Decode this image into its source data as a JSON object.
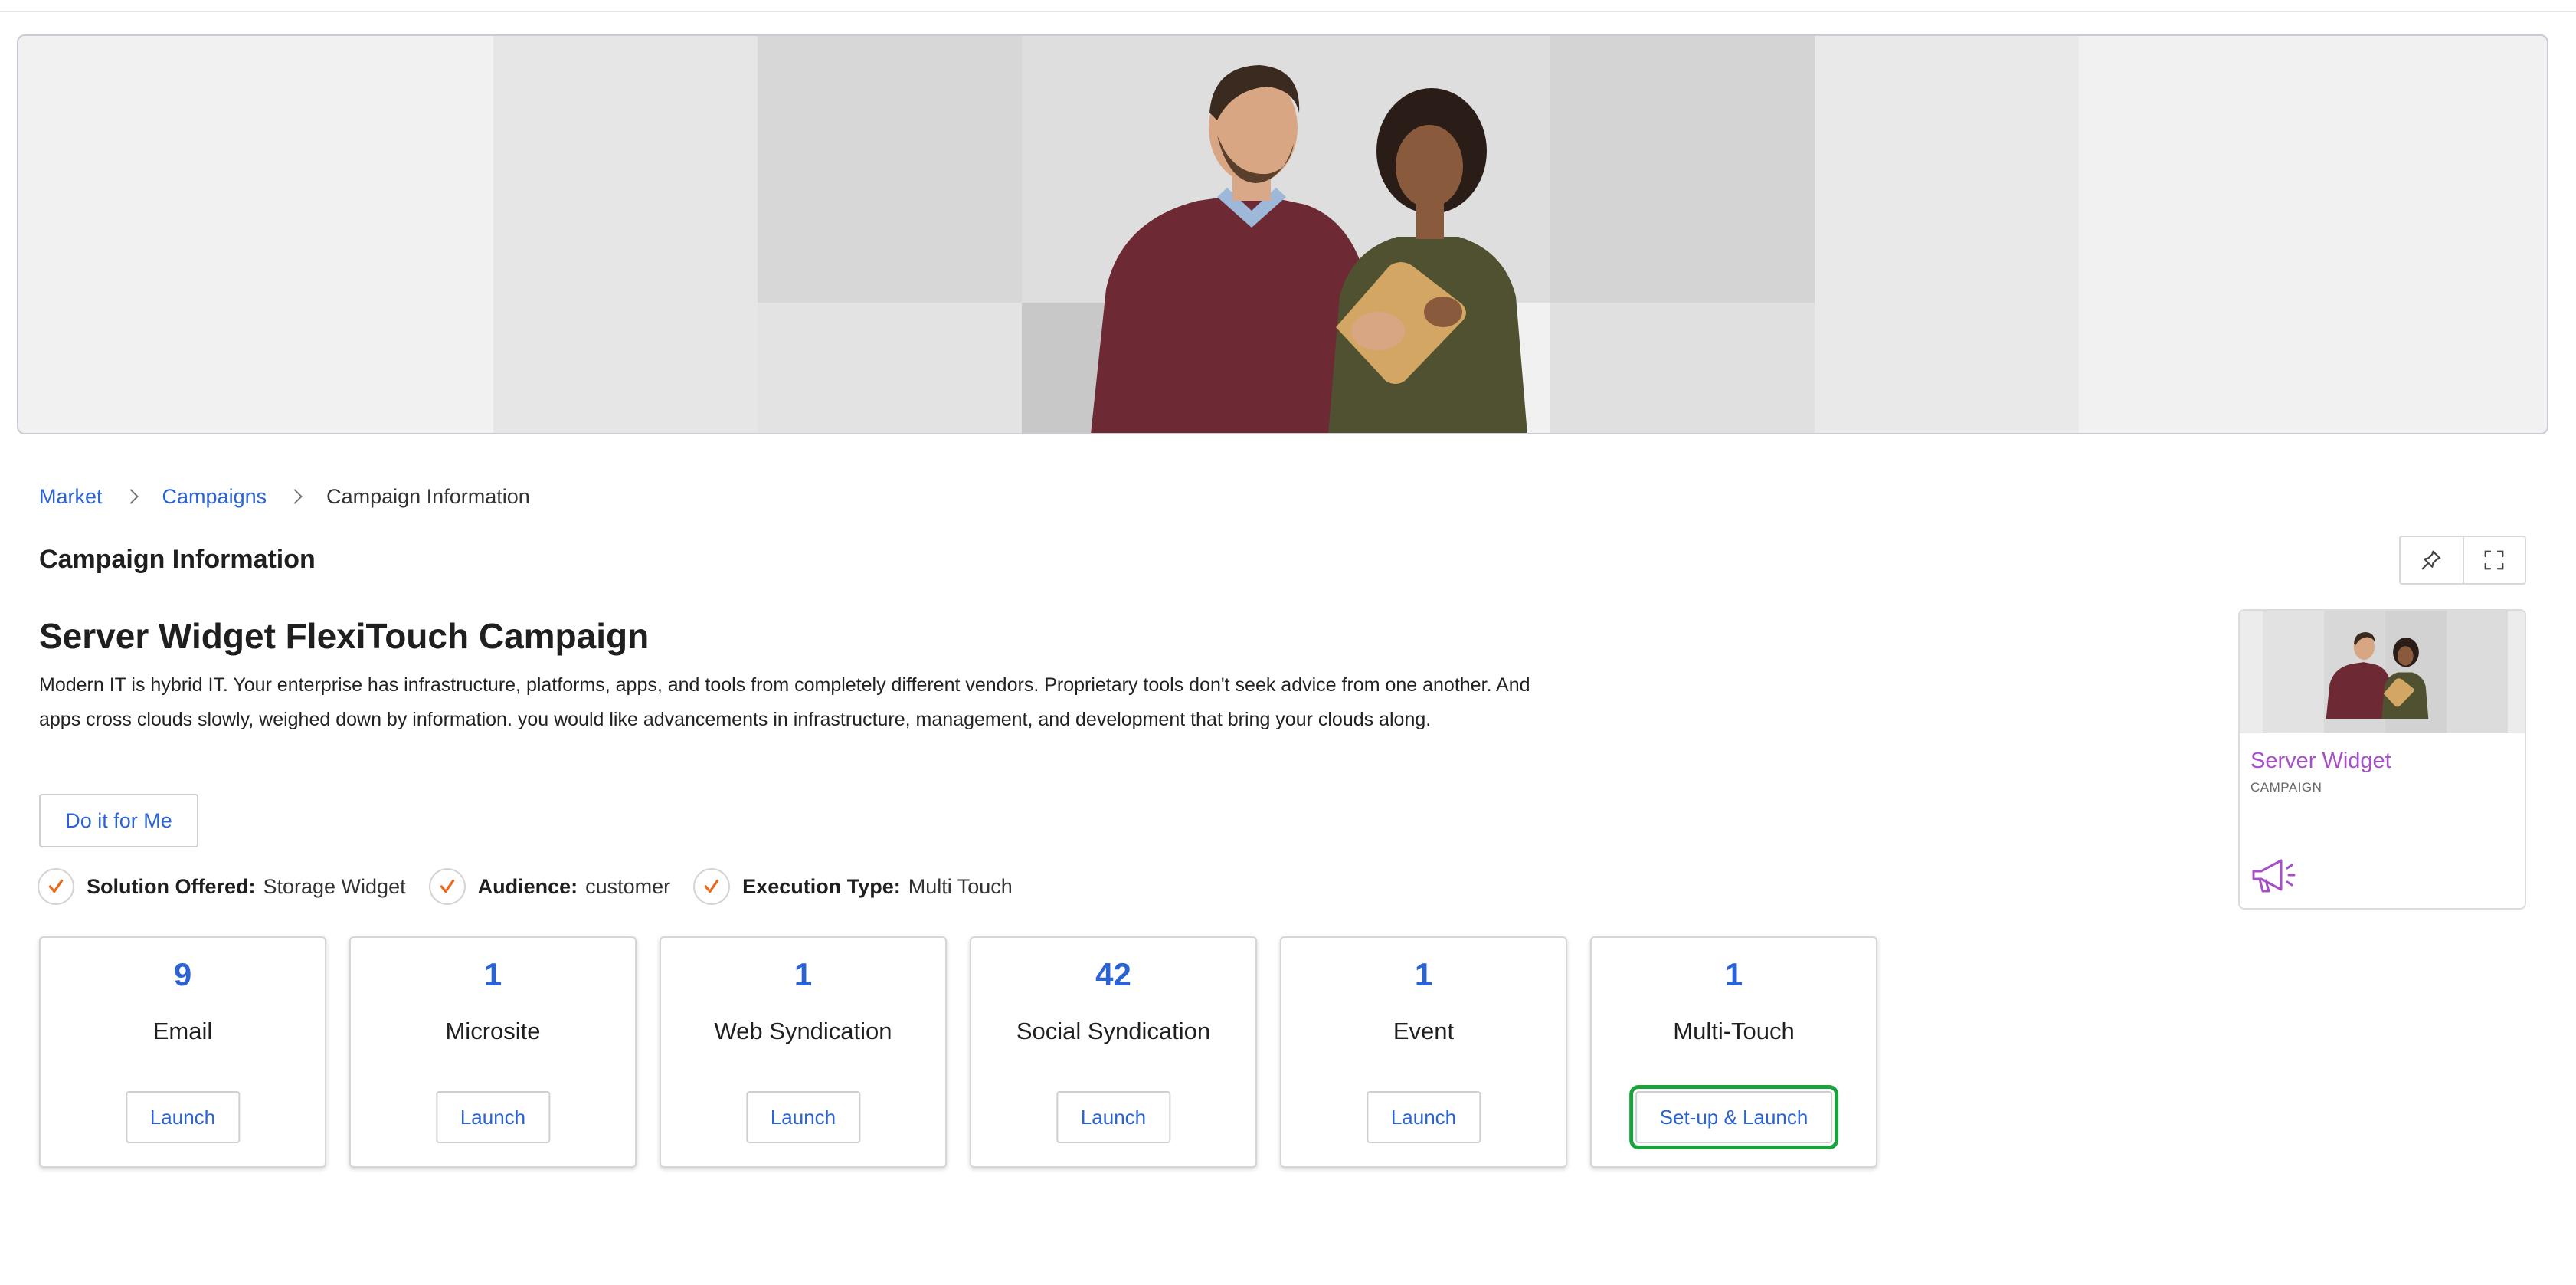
{
  "breadcrumb": {
    "items": [
      "Market",
      "Campaigns",
      "Campaign Information"
    ]
  },
  "page": {
    "title": "Campaign Information"
  },
  "campaign": {
    "name": "Server Widget FlexiTouch Campaign",
    "description": "Modern IT is hybrid IT. Your enterprise has infrastructure, platforms, apps, and tools from completely different vendors. Proprietary tools don't seek advice from one another. And apps cross clouds slowly, weighed down by information. you would like advancements in infrastructure, management, and development that bring your clouds along.",
    "do_it_label": "Do it for Me",
    "attributes": [
      {
        "label": "Solution Offered:",
        "value": "Storage Widget"
      },
      {
        "label": "Audience:",
        "value": "customer"
      },
      {
        "label": "Execution Type:",
        "value": "Multi Touch"
      }
    ]
  },
  "tiles": [
    {
      "count": "9",
      "name": "Email",
      "button": "Launch"
    },
    {
      "count": "1",
      "name": "Microsite",
      "button": "Launch"
    },
    {
      "count": "1",
      "name": "Web Syndication",
      "button": "Launch"
    },
    {
      "count": "42",
      "name": "Social Syndication",
      "button": "Launch"
    },
    {
      "count": "1",
      "name": "Event",
      "button": "Launch"
    },
    {
      "count": "1",
      "name": "Multi-Touch",
      "button": "Set-up & Launch"
    }
  ],
  "side_card": {
    "name": "Server Widget",
    "type": "CAMPAIGN",
    "icon": "megaphone-icon"
  },
  "toolbar": {
    "icons": [
      "pin-icon",
      "fullscreen-icon"
    ]
  },
  "colors": {
    "link": "#2b63d4",
    "accent_purple": "#a64fc9",
    "check_orange": "#e86a1a",
    "highlight_green": "#1aa33c"
  }
}
